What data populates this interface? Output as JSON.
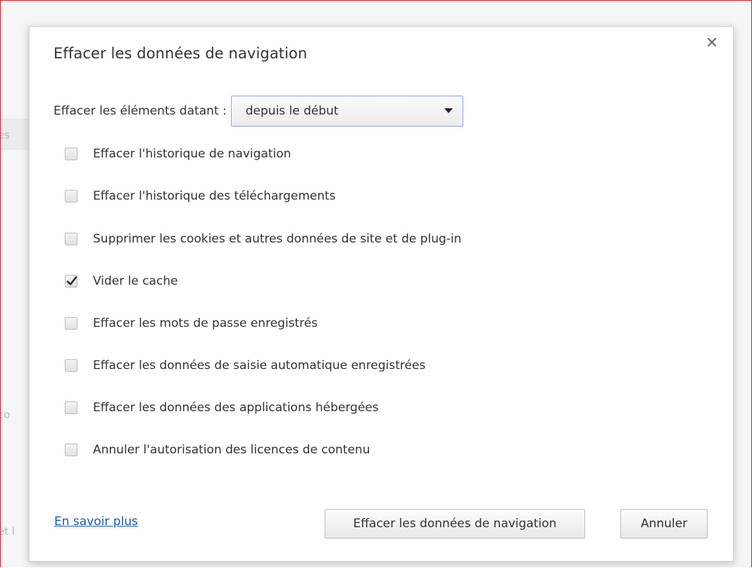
{
  "background": {
    "fragments": [
      "es",
      "co",
      "et l"
    ]
  },
  "dialog": {
    "title": "Effacer les données de navigation",
    "close_icon": "close-icon",
    "range": {
      "label": "Effacer les éléments datant :",
      "selected": "depuis le début"
    },
    "options": [
      {
        "label": "Effacer l'historique de navigation",
        "checked": false
      },
      {
        "label": "Effacer l'historique des téléchargements",
        "checked": false
      },
      {
        "label": "Supprimer les cookies et autres données de site et de plug-in",
        "checked": false
      },
      {
        "label": "Vider le cache",
        "checked": true
      },
      {
        "label": "Effacer les mots de passe enregistrés",
        "checked": false
      },
      {
        "label": "Effacer les données de saisie automatique enregistrées",
        "checked": false
      },
      {
        "label": "Effacer les données des applications hébergées",
        "checked": false
      },
      {
        "label": "Annuler l'autorisation des licences de contenu",
        "checked": false
      }
    ],
    "learn_more": "En savoir plus",
    "buttons": {
      "clear": "Effacer les données de navigation",
      "cancel": "Annuler"
    }
  },
  "colors": {
    "frame_border": "#c81e2b",
    "link": "#1d5ba8",
    "select_border": "#8da6d8"
  }
}
